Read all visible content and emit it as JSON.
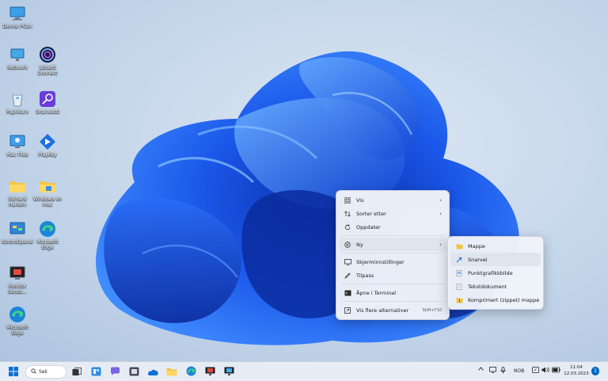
{
  "desktop_icons": [
    {
      "label": "Denne PCen",
      "icon": "monitor-icon"
    },
    {
      "label": "Nettverk",
      "icon": "network-icon"
    },
    {
      "label": "Ubisoft Connect",
      "icon": "ubisoft-icon"
    },
    {
      "label": "Papirkurv",
      "icon": "recycle-bin-icon"
    },
    {
      "label": "Snarveisti",
      "icon": "shortcut-app-icon"
    },
    {
      "label": "Mac Files",
      "icon": "mac-files-icon"
    },
    {
      "label": "PlayKey",
      "icon": "playkey-icon"
    },
    {
      "label": "Richard Hansen",
      "icon": "folder-icon"
    },
    {
      "label": "Windows on mac",
      "icon": "folder-icon"
    },
    {
      "label": "Kontrollpanel",
      "icon": "control-panel-icon"
    },
    {
      "label": "Microsoft Edge",
      "icon": "edge-icon"
    },
    {
      "label": "Monitor Senso...",
      "icon": "monitor-app-icon"
    },
    {
      "label": "Microsoft Edge",
      "icon": "edge-icon"
    }
  ],
  "context_menu": {
    "items": [
      {
        "label": "Vis",
        "icon": "grid-icon",
        "submenu": true
      },
      {
        "label": "Sorter etter",
        "icon": "sort-icon",
        "submenu": true
      },
      {
        "label": "Oppdater",
        "icon": "refresh-icon"
      },
      {
        "label": "Ny",
        "icon": "new-icon",
        "submenu": true
      },
      {
        "label": "Skjerminnstillinger",
        "icon": "display-settings-icon"
      },
      {
        "label": "Tilpass",
        "icon": "personalize-icon"
      },
      {
        "label": "Åpne i Terminal",
        "icon": "terminal-icon"
      },
      {
        "label": "Vis flere alternativer",
        "icon": "more-options-icon",
        "shortcut": "Skift+F10"
      }
    ]
  },
  "submenu_new": {
    "items": [
      {
        "label": "Mappe",
        "icon": "folder-icon"
      },
      {
        "label": "Snarvei",
        "icon": "shortcut-icon"
      },
      {
        "label": "Punktgrafikkbilde",
        "icon": "bitmap-icon"
      },
      {
        "label": "Tekstdokument",
        "icon": "text-document-icon"
      },
      {
        "label": "Komprimert (zippet) mappe",
        "icon": "zip-folder-icon"
      }
    ]
  },
  "taskbar": {
    "search_label": "Søk",
    "language": "NOB",
    "time": "11:04",
    "date": "12.03.2023",
    "notification_count": "1"
  },
  "colors": {
    "accent": "#0067c0",
    "wallpaper_blue": "#1a56e8",
    "menu_bg": "#f0f3f9",
    "taskbar_bg": "#e7ecf4"
  }
}
